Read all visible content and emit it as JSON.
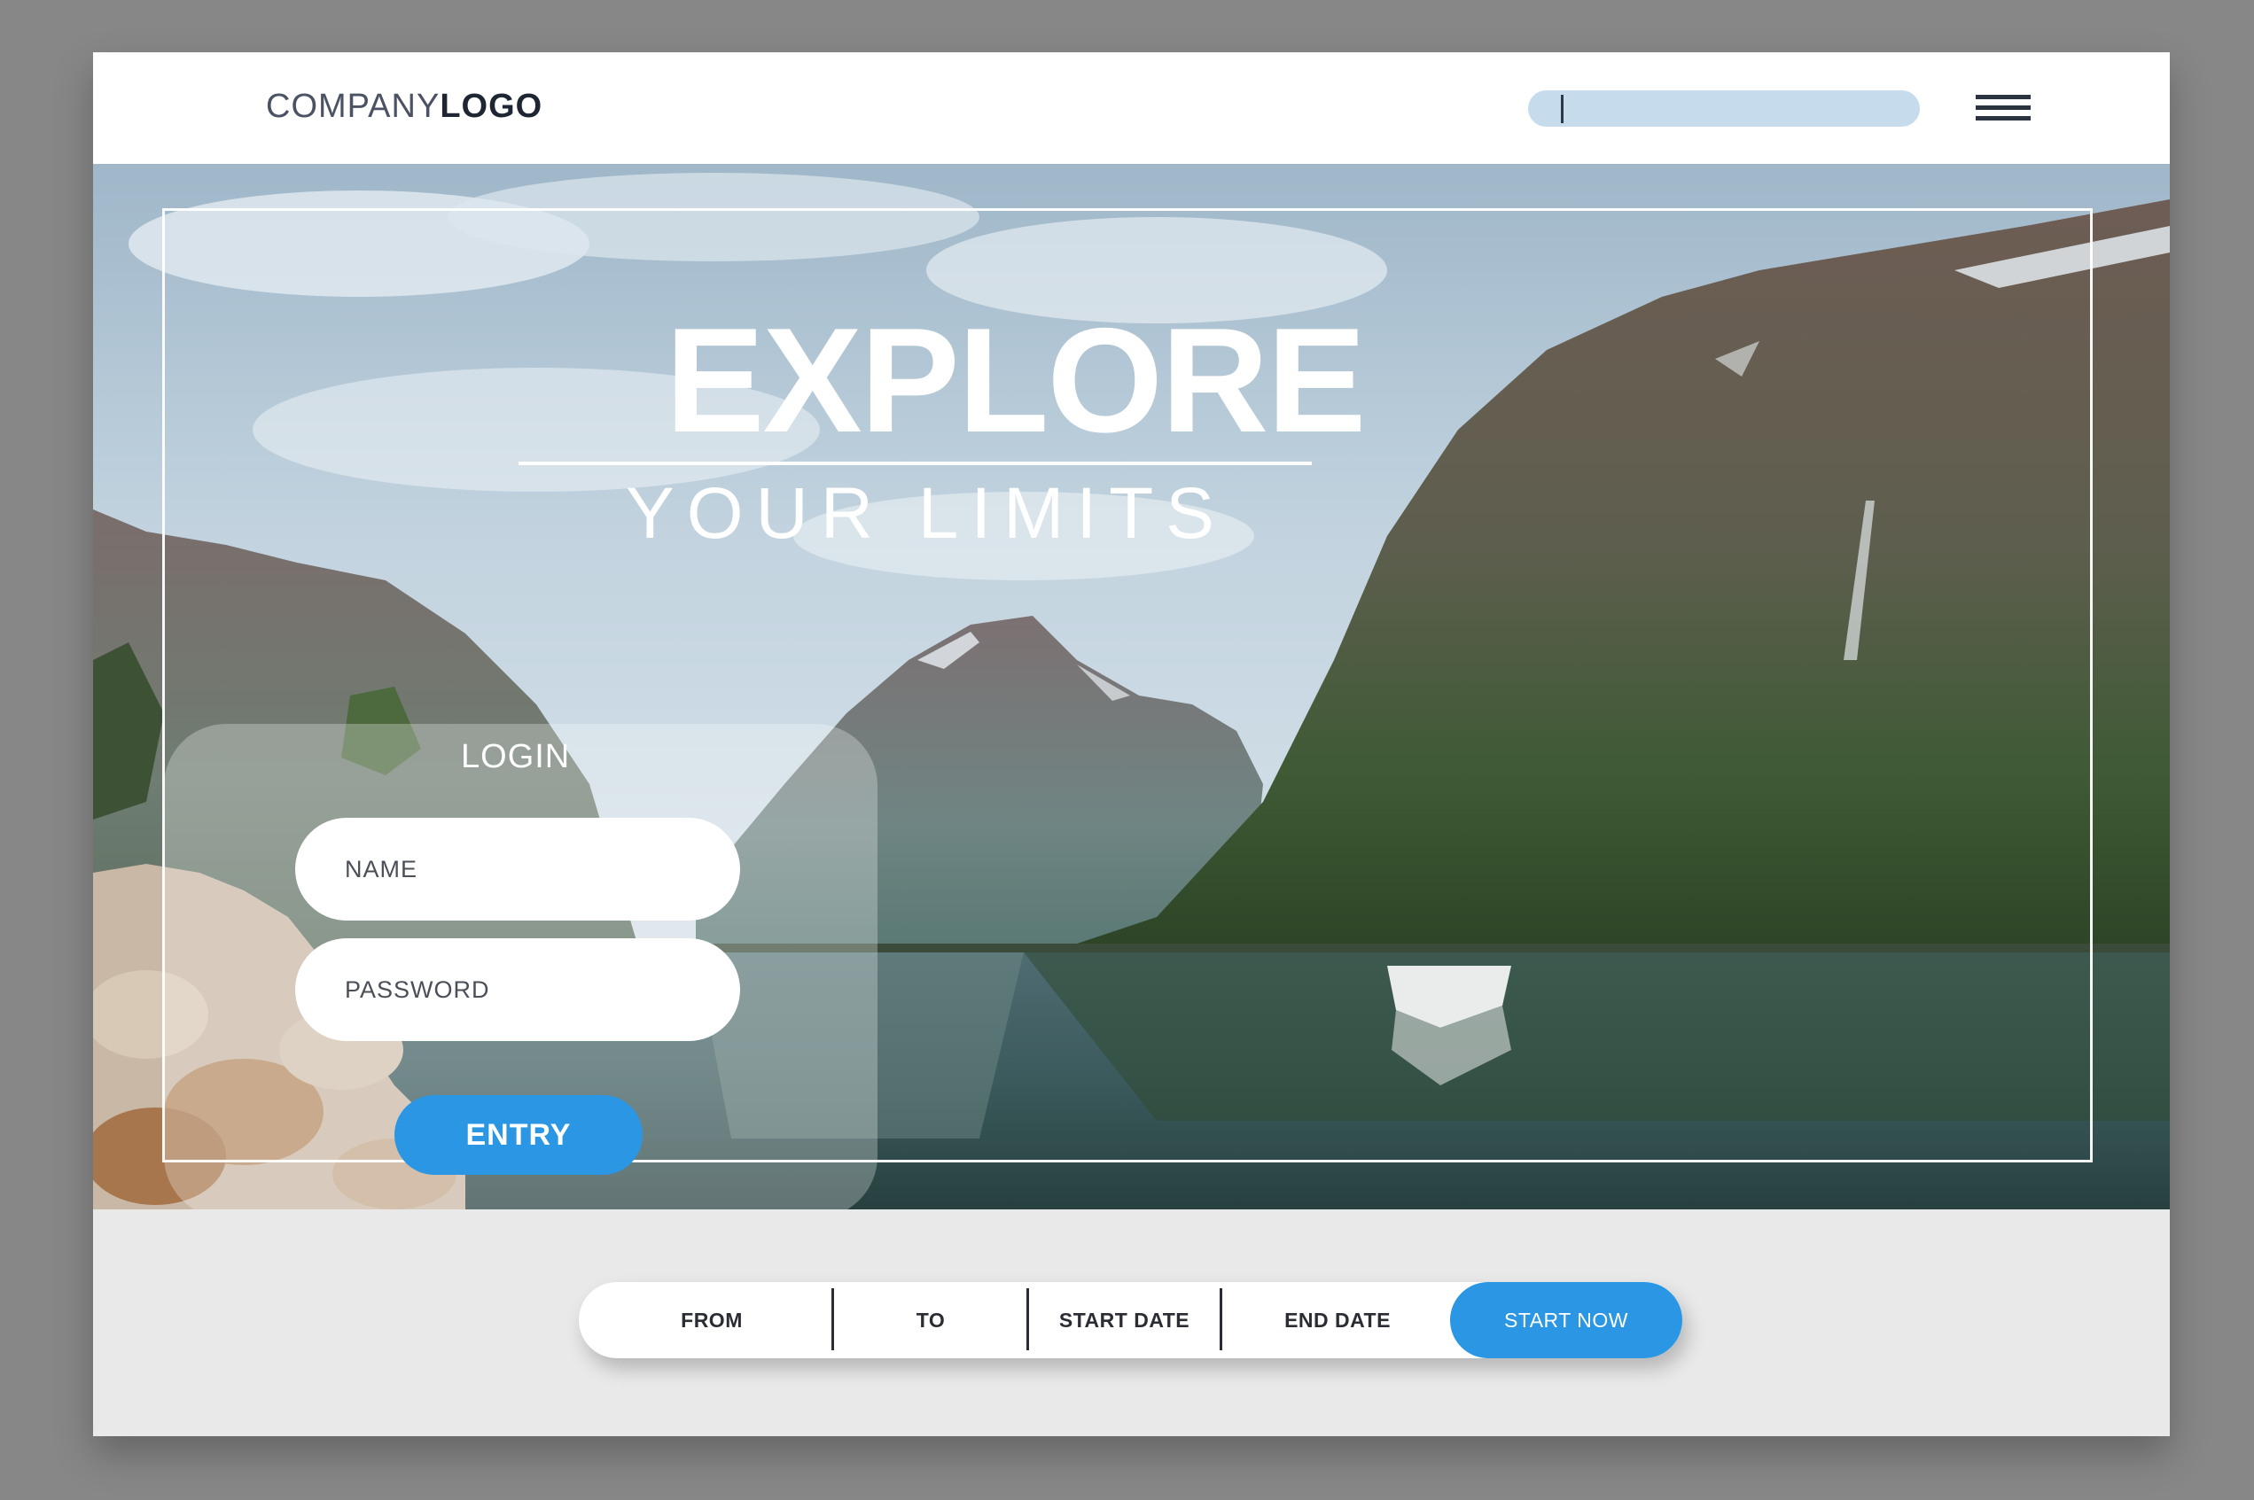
{
  "header": {
    "logo_light": "COMPANY",
    "logo_bold": "LOGO",
    "search_value": "",
    "menu_icon": "hamburger-menu-icon"
  },
  "hero": {
    "title": "EXPLORE",
    "subtitle": "YOUR LIMITS",
    "background": "mountain-lake-with-boat"
  },
  "login": {
    "heading": "LOGIN",
    "name_placeholder": "NAME",
    "password_placeholder": "PASSWORD",
    "entry_label": "ENTRY"
  },
  "booking": {
    "from_label": "FROM",
    "to_label": "TO",
    "start_date_label": "START DATE",
    "end_date_label": "END DATE",
    "start_now_label": "START NOW"
  },
  "colors": {
    "accent": "#2a96e4",
    "search_bg": "#c6dced",
    "page_bg": "#e9e9e9",
    "outer_bg": "#878787"
  }
}
